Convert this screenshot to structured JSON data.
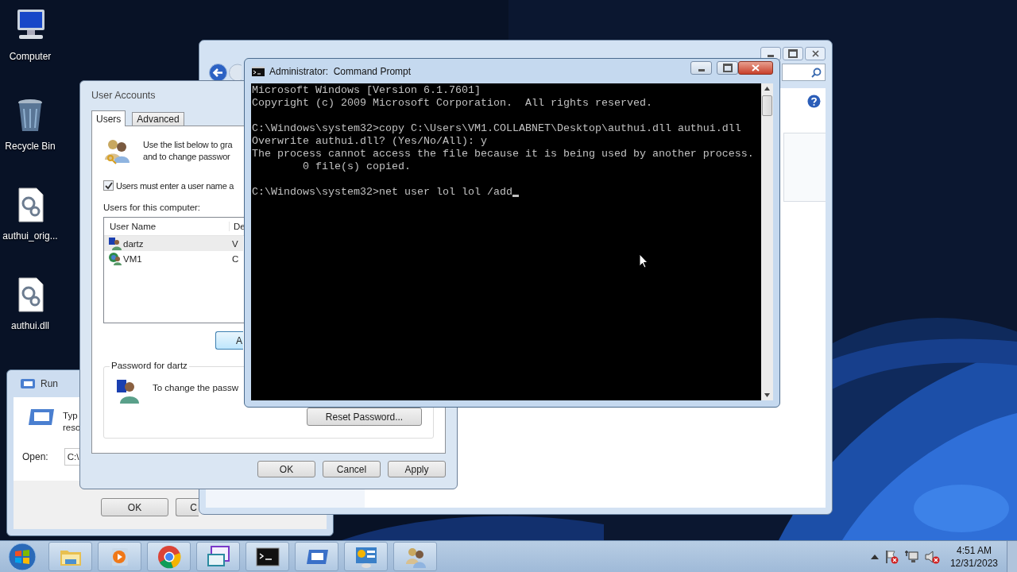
{
  "desktop_icons": [
    {
      "label": "Computer",
      "kind": "computer"
    },
    {
      "label": "Recycle Bin",
      "kind": "recycle-bin"
    },
    {
      "label": "authui_orig...",
      "kind": "file"
    },
    {
      "label": "authui.dll",
      "kind": "file"
    }
  ],
  "run_dialog": {
    "title": "Run",
    "description_lines": [
      "Typ",
      "reso"
    ],
    "open_label": "Open:",
    "open_value": "C:\\",
    "buttons": [
      "OK",
      "C"
    ]
  },
  "user_accounts": {
    "title": "User Accounts",
    "tabs": [
      {
        "label": "Users",
        "selected": true
      },
      {
        "label": "Advanced",
        "selected": false
      }
    ],
    "intro_lines": [
      "Use the list below to gra",
      "and to change passwor"
    ],
    "require_login": {
      "label": "Users must enter a user name a",
      "checked": true
    },
    "list_label": "Users for this computer:",
    "columns": [
      "User Name",
      "De"
    ],
    "users": [
      {
        "name": "dartz",
        "column_2": "V",
        "kind": "local",
        "selected": true
      },
      {
        "name": "VM1",
        "column_2": "C",
        "kind": "domain",
        "selected": false
      }
    ],
    "add_button": "A",
    "password_group": {
      "title": "Password for dartz",
      "text": "To change the passw",
      "button": "Reset Password..."
    },
    "buttons": [
      "OK",
      "Cancel",
      "Apply"
    ]
  },
  "command_prompt": {
    "title": "Administrator:  Command Prompt",
    "blocks": [
      [
        "Microsoft Windows [Version 6.1.7601]",
        "Copyright (c) 2009 Microsoft Corporation.  All rights reserved."
      ],
      [
        "C:\\Windows\\system32>copy C:\\Users\\VM1.COLLABNET\\Desktop\\authui.dll authui.dll",
        "Overwrite authui.dll? (Yes/No/All): y",
        "The process cannot access the file because it is being used by another process.",
        "        0 file(s) copied."
      ],
      [
        "C:\\Windows\\system32>net user lol lol /add"
      ]
    ],
    "cursor": true
  },
  "taskbar": {
    "buttons": [
      {
        "kind": "folder"
      },
      {
        "kind": "media"
      },
      {
        "kind": "browser"
      },
      {
        "kind": "switcher"
      },
      {
        "kind": "terminal"
      },
      {
        "kind": "run"
      },
      {
        "kind": "control-panel"
      },
      {
        "kind": "users"
      }
    ],
    "time": "4:51 AM",
    "date": "12/31/2023"
  }
}
